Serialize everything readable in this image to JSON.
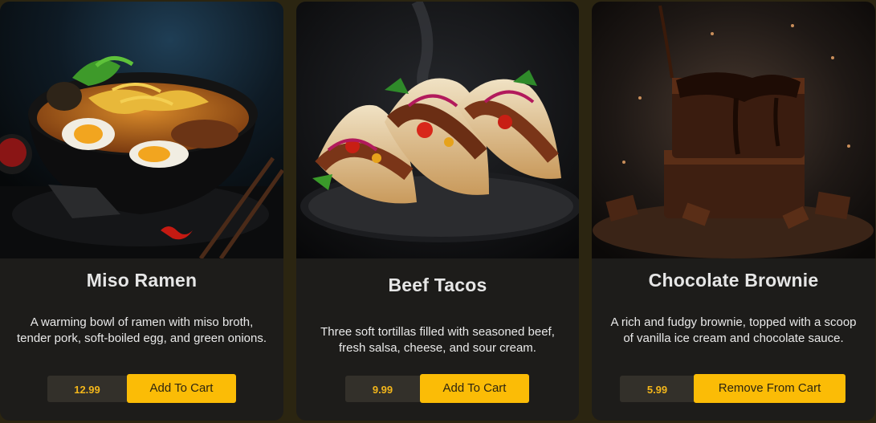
{
  "products": [
    {
      "name": "Miso Ramen",
      "description": "A warming bowl of ramen with miso broth, tender pork, soft-boiled egg, and green onions.",
      "price": "12.99",
      "button_label": "Add To Cart"
    },
    {
      "name": "Beef Tacos",
      "description": "Three soft tortillas filled with seasoned beef, fresh salsa, cheese, and sour cream.",
      "price": "9.99",
      "button_label": "Add To Cart"
    },
    {
      "name": "Chocolate Brownie",
      "description": "A rich and fudgy brownie, topped with a scoop of vanilla ice cream and chocolate sauce.",
      "price": "5.99",
      "button_label": "Remove From Cart"
    }
  ],
  "colors": {
    "page_background": "#2b2511",
    "card_background": "#1d1c1a",
    "price_background": "#33302a",
    "price_text": "#f3b61b",
    "button_background": "#fbbc06",
    "button_text": "#2d2510"
  }
}
